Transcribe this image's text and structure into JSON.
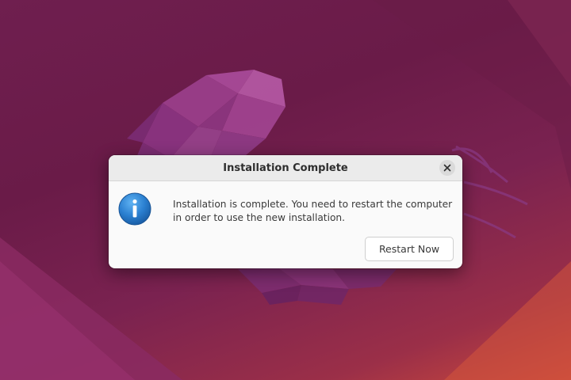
{
  "dialog": {
    "title": "Installation Complete",
    "message": "Installation is complete. You need to restart the computer in order to use the new installation.",
    "primary_button_label": "Restart Now",
    "icon": "info-icon",
    "close_icon": "close-icon"
  },
  "colors": {
    "wallpaper_base": "#6f1f4f",
    "wallpaper_accent": "#c9483c",
    "dialog_background": "#fafafa",
    "titlebar_background": "#ebebeb",
    "info_icon_blue": "#2a7fd0"
  }
}
